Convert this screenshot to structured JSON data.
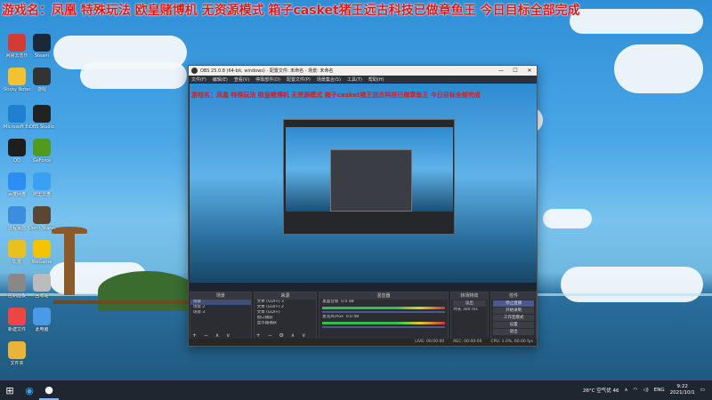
{
  "overlay": {
    "headline": "游戏名：凤凰 特殊玩法 欧皇赌博机 无资源模式 箱子casket猪王远古科技已做章鱼王 今日目标全部完成"
  },
  "desktop_icons": [
    {
      "label": "网易云音乐",
      "icon": "music-icon",
      "color": "#d43c33"
    },
    {
      "label": "Steam",
      "icon": "steam-icon",
      "color": "#1b2838"
    },
    {
      "label": "Sticky Notes",
      "icon": "note-icon",
      "color": "#f2c230"
    },
    {
      "label": "游戏",
      "icon": "game-icon",
      "color": "#333"
    },
    {
      "label": "Microsoft Edge",
      "icon": "browser-icon",
      "color": "#1f7fd1"
    },
    {
      "label": "OBS Studio",
      "icon": "obs-icon",
      "color": "#222"
    },
    {
      "label": "QQ",
      "icon": "qq-icon",
      "color": "#1e1e1e"
    },
    {
      "label": "GeForce",
      "icon": "nvidia-icon",
      "color": "#4f9a1f"
    },
    {
      "label": "百度网盘",
      "icon": "cloud-icon",
      "color": "#2a8ef2"
    },
    {
      "label": "阿里云盘",
      "icon": "cloud-icon",
      "color": "#3aa1f2"
    },
    {
      "label": "远程桌面",
      "icon": "remote-icon",
      "color": "#3c8dde"
    },
    {
      "label": "Don't Starve",
      "icon": "game-icon",
      "color": "#5a4632"
    },
    {
      "label": "饥荒",
      "icon": "game-icon",
      "color": "#e8c020"
    },
    {
      "label": "WeGame",
      "icon": "wegame-icon",
      "color": "#f4c400"
    },
    {
      "label": "控制面板",
      "icon": "settings-icon",
      "color": "#888"
    },
    {
      "label": "回收站",
      "icon": "recycle-bin-icon",
      "color": "#bbb"
    },
    {
      "label": "新建文件",
      "icon": "file-icon",
      "color": "#e44"
    },
    {
      "label": "此电脑",
      "icon": "computer-icon",
      "color": "#4a9ae8"
    },
    {
      "label": "文件夹",
      "icon": "folder-icon",
      "color": "#e8b53a"
    }
  ],
  "obs": {
    "title": "OBS 25.0.8 (64-bit, windows) - 配置文件: 未命名 - 场景: 未命名",
    "menu": [
      "文件(F)",
      "编辑(E)",
      "查看(V)",
      "停靠部件(D)",
      "配置文件(P)",
      "场景集合(S)",
      "工具(T)",
      "帮助(H)"
    ],
    "preview_text": "游戏名：凤凰 特殊玩法 欧皇赌博机 无资源模式 箱子casket猪王远古科技已做章鱼王 今日目标全部完成",
    "docks": {
      "scenes": {
        "header": "场景",
        "items": [
          "场景",
          "场景 2",
          "场景 3"
        ]
      },
      "sources": {
        "header": "来源",
        "items": [
          "文本 (GDI+) 3",
          "文本 (GDI+) 2",
          "文本 (GDI+)",
          "窗口捕获",
          "显示器捕获"
        ]
      },
      "mixer": {
        "header": "混音器",
        "channels": [
          {
            "name": "桌面音频",
            "level": "0.0 dB"
          },
          {
            "name": "麦克风/Aux",
            "level": "0.0 dB"
          }
        ]
      },
      "transitions": {
        "header": "转场特效",
        "type": "淡出",
        "duration_label": "时长",
        "duration": "300 ms"
      },
      "controls": {
        "header": "控件",
        "buttons": [
          "停止直播",
          "开始录制",
          "工作室模式",
          "设置",
          "退出"
        ]
      }
    },
    "status": {
      "live": "LIVE: 00:00:00",
      "rec": "REC: 00:00:00",
      "cpu": "CPU: 1.0%, 60.00 fps"
    }
  },
  "taskbar": {
    "weather": "26°C 空气优 46",
    "lang": "ENG",
    "time": "9:22",
    "date": "2021/10/1"
  }
}
